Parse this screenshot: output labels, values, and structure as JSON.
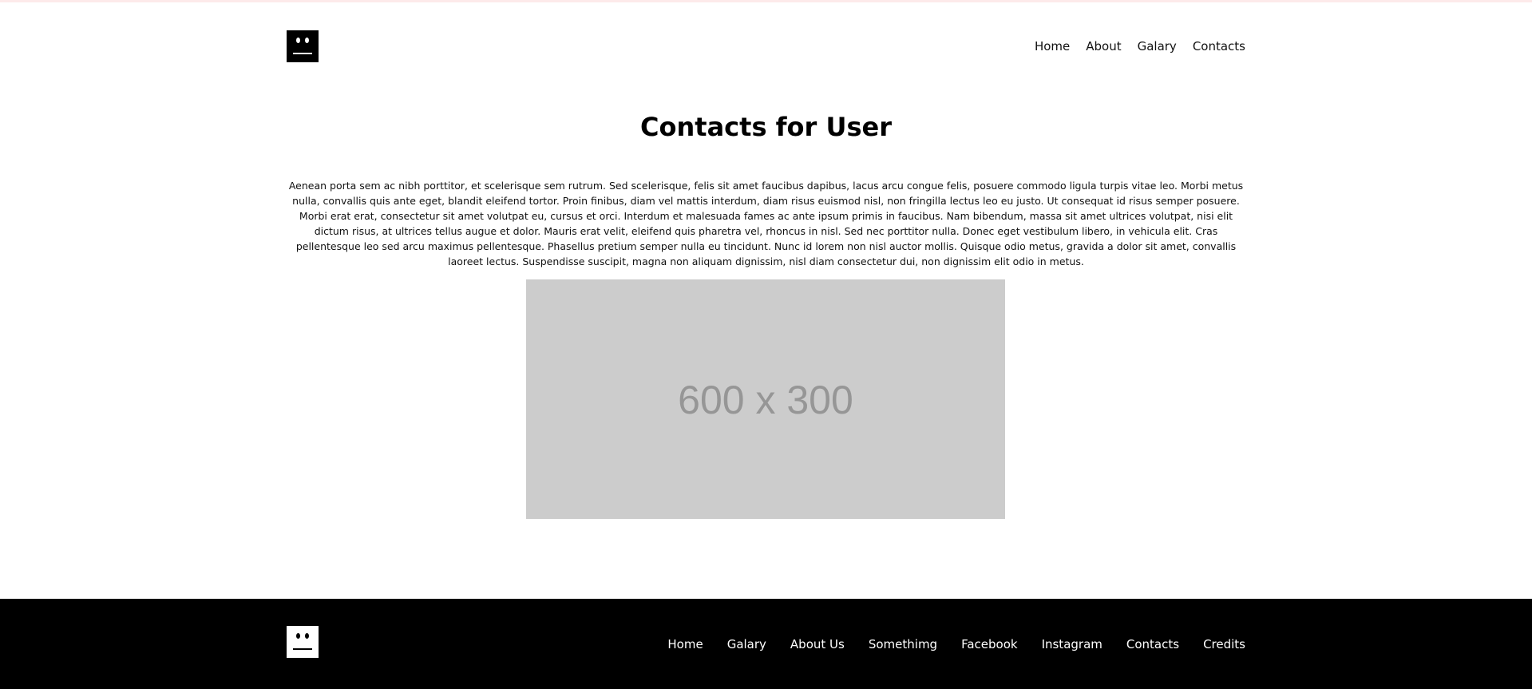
{
  "header": {
    "nav": [
      "Home",
      "About",
      "Galary",
      "Contacts"
    ]
  },
  "main": {
    "title": "Contacts for User",
    "paragraph": "Aenean porta sem ac nibh porttitor, et scelerisque sem rutrum. Sed scelerisque, felis sit amet faucibus dapibus, lacus arcu congue felis, posuere commodo ligula turpis vitae leo. Morbi metus nulla, convallis quis ante eget, blandit eleifend tortor. Proin finibus, diam vel mattis interdum, diam risus euismod nisl, non fringilla lectus leo eu justo. Ut consequat id risus semper posuere. Morbi erat erat, consectetur sit amet volutpat eu, cursus et orci. Interdum et malesuada fames ac ante ipsum primis in faucibus. Nam bibendum, massa sit amet ultrices volutpat, nisi elit dictum risus, at ultrices tellus augue et dolor. Mauris erat velit, eleifend quis pharetra vel, rhoncus in nisl. Sed nec porttitor nulla. Donec eget vestibulum libero, in vehicula elit. Cras pellentesque leo sed arcu maximus pellentesque. Phasellus pretium semper nulla eu tincidunt. Nunc id lorem non nisl auctor mollis. Quisque odio metus, gravida a dolor sit amet, convallis laoreet lectus. Suspendisse suscipit, magna non aliquam dignissim, nisl diam consectetur dui, non dignissim elit odio in metus.",
    "image_placeholder": "600 x 300"
  },
  "footer": {
    "nav": [
      "Home",
      "Galary",
      "About Us",
      "Somethimg",
      "Facebook",
      "Instagram",
      "Contacts",
      "Credits"
    ]
  },
  "icons": {
    "logo": "face-logo-icon"
  },
  "colors": {
    "footer_bg": "#000000",
    "placeholder_bg": "#cccccc",
    "placeholder_text": "#969696"
  }
}
